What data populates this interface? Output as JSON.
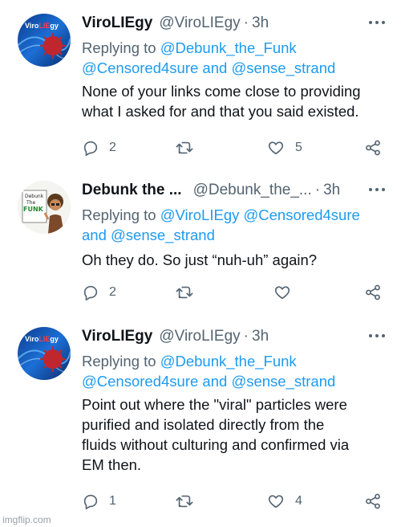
{
  "tweets": [
    {
      "name": "ViroLIEgy",
      "handle": "@ViroLIEgy",
      "time": "3h",
      "reply_prefix": "Replying to",
      "reply_line1": "@Debunk_the_Funk",
      "reply_line2a": "@Censored4sure",
      "reply_and": "and",
      "reply_line2b": "@sense_strand",
      "body_lines": [
        "None of your links come close to providing",
        "what I asked for and that you said existed."
      ],
      "replies": "2",
      "retweets": "",
      "likes": "5"
    },
    {
      "name": "Debunk the ...",
      "handle": "@Debunk_the_...",
      "time": "3h",
      "reply_prefix": "Replying to",
      "reply_line1a": "@ViroLIEgy",
      "reply_line1b": "@Censored4sure",
      "reply_and": "and",
      "reply_line2": "@sense_strand",
      "body_lines": [
        "Oh they do. So just “nuh-uh” again?"
      ],
      "replies": "2",
      "retweets": "",
      "likes": ""
    },
    {
      "name": "ViroLIEgy",
      "handle": "@ViroLIEgy",
      "time": "3h",
      "reply_prefix": "Replying to",
      "reply_line1": "@Debunk_the_Funk",
      "reply_line2a": "@Censored4sure",
      "reply_and": "and",
      "reply_line2b": "@sense_strand",
      "body_lines": [
        "Point out where the \"viral\" particles were",
        "purified and isolated directly from the",
        "fluids without culturing and confirmed via",
        "EM then."
      ],
      "replies": "1",
      "retweets": "",
      "likes": "4"
    }
  ],
  "avatar2_text": [
    "Debunk",
    "The",
    "FUNK"
  ],
  "watermark": "imgflip.com",
  "colors": {
    "link": "#1d9bf0",
    "secondary": "#536471",
    "text": "#0f1419"
  },
  "icons": [
    "reply-icon",
    "retweet-icon",
    "like-icon",
    "share-icon",
    "more-icon"
  ]
}
